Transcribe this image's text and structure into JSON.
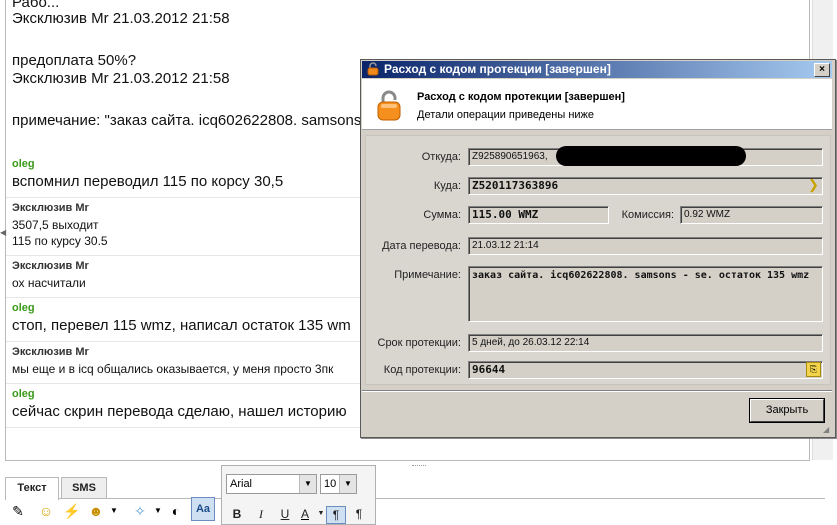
{
  "chat": {
    "messages": [
      {
        "author": "",
        "lines": [
          "Эксклюзив Mr 21.03.2012 21:58"
        ],
        "size": "big"
      },
      {
        "author": "",
        "lines": [
          "предоплата 50%?",
          "Эксклюзив Mr 21.03.2012 21:58"
        ],
        "size": "big"
      },
      {
        "author": "",
        "lines": [
          "примечание: \"заказ сайта. icq602622808. samsons"
        ],
        "size": "big"
      },
      {
        "author": "oleg",
        "lines": [
          "вспомнил переводил 115 по корсу 30,5"
        ],
        "size": "big"
      },
      {
        "author": "Эксклюзив Mr",
        "lines": [
          "3507,5 выходит",
          "115 по курсу 30.5"
        ],
        "size": "small"
      },
      {
        "author": "Эксклюзив Mr",
        "lines": [
          "ох насчитали"
        ],
        "size": "small"
      },
      {
        "author": "oleg",
        "lines": [
          "стоп, перевел 115 wmz, написал остаток 135 wm"
        ],
        "size": "big"
      },
      {
        "author": "Эксклюзив Mr",
        "lines": [
          "мы еще и в icq общались оказывается, у меня просто 3пк"
        ],
        "size": "small"
      },
      {
        "author": "oleg",
        "lines": [
          "сейчас скрин перевода сделаю, нашел историю"
        ],
        "size": "big"
      }
    ]
  },
  "input_tabs": {
    "text": "Текст",
    "sms": "SMS"
  },
  "format": {
    "font": "Arial",
    "size": "10",
    "bold": "B",
    "italic": "I",
    "underline": "U",
    "color": "A",
    "aa": "Aa"
  },
  "dialog": {
    "title": "Расход с кодом протекции [завершен]",
    "header_title": "Расход с кодом протекции [завершен]",
    "header_sub": "Детали операции приведены ниже",
    "fields": {
      "from_label": "Откуда:",
      "from_value": "Z925890651963,",
      "to_label": "Куда:",
      "to_value": "Z520117363896",
      "amount_label": "Сумма:",
      "amount_value": "115.00 WMZ",
      "fee_label": "Комиссия:",
      "fee_value": "0.92 WMZ",
      "date_label": "Дата перевода:",
      "date_value": "21.03.12 21:14",
      "note_label": "Примечание:",
      "note_value": "заказ сайта. icq602622808. samsons - se. остаток 135 wmz",
      "term_label": "Срок протекции:",
      "term_value": "5 дней, до 26.03.12 22:14",
      "code_label": "Код протекции:",
      "code_value": "96644"
    },
    "close_label": "Закрыть",
    "close_x": "×"
  },
  "colors": {
    "accent_green": "#3a9a1a",
    "titlebar": "#0a246a"
  }
}
